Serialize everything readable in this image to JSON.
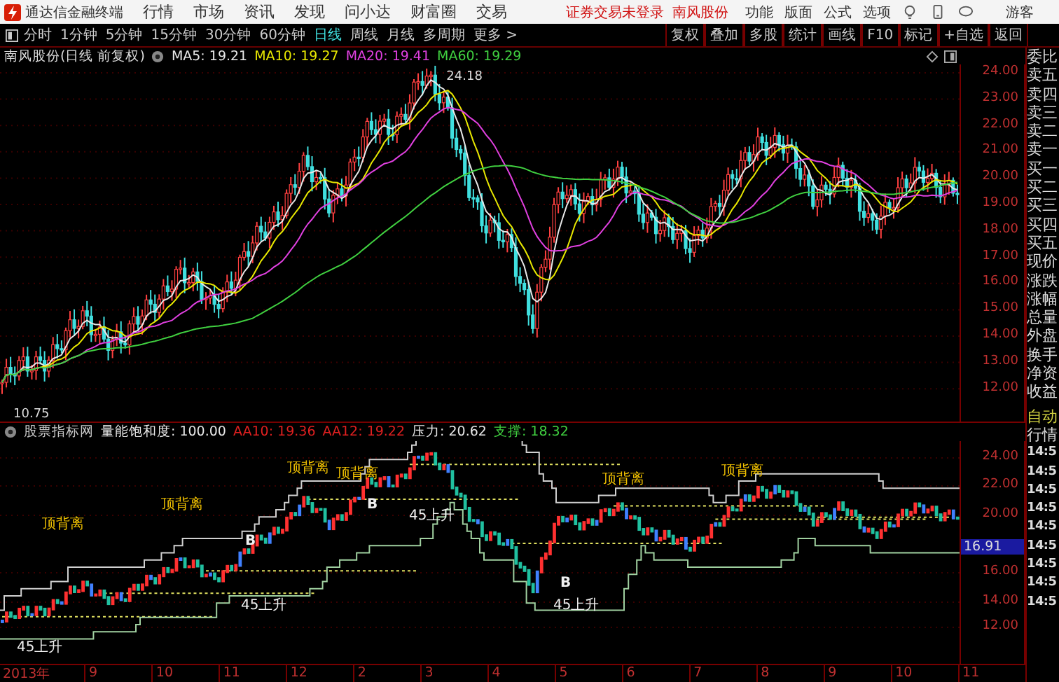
{
  "title_bar": {
    "app_name": "通达信金融终端",
    "menu": [
      "行情",
      "市场",
      "资讯",
      "发现",
      "问小达",
      "财富圈",
      "交易"
    ],
    "login_status": "证券交易未登录",
    "stock_name": "南风股份",
    "tools": [
      "功能",
      "版面",
      "公式",
      "选项"
    ],
    "user": "游客"
  },
  "toolbar": {
    "periods": [
      {
        "label": "分时",
        "selected": false
      },
      {
        "label": "1分钟",
        "selected": false
      },
      {
        "label": "5分钟",
        "selected": false
      },
      {
        "label": "15分钟",
        "selected": false
      },
      {
        "label": "30分钟",
        "selected": false
      },
      {
        "label": "60分钟",
        "selected": false
      },
      {
        "label": "日线",
        "selected": true
      },
      {
        "label": "周线",
        "selected": false
      },
      {
        "label": "月线",
        "selected": false
      },
      {
        "label": "多周期",
        "selected": false
      },
      {
        "label": "更多 >",
        "selected": false
      }
    ],
    "buttons": [
      "复权",
      "叠加",
      "多股",
      "统计",
      "画线",
      "F10",
      "标记",
      "+自选",
      "返回"
    ]
  },
  "price_chart": {
    "title": "南风股份(日线 前复权)",
    "legend": [
      {
        "label": "MA5: 19.21",
        "color": "#e8e8e8"
      },
      {
        "label": "MA10: 19.27",
        "color": "#e8e800"
      },
      {
        "label": "MA20: 19.41",
        "color": "#e040e0"
      },
      {
        "label": "MA60: 19.29",
        "color": "#40d040"
      }
    ],
    "high_label": "24.18",
    "low_label": "10.75",
    "axis_labels": [
      "24.00",
      "23.00",
      "22.00",
      "21.00",
      "20.00",
      "19.00",
      "18.00",
      "17.00",
      "16.00",
      "15.00",
      "14.00",
      "13.00",
      "12.00"
    ]
  },
  "indicator_chart": {
    "legend": [
      {
        "label": "股票指标网",
        "color": "#c8c8c8"
      },
      {
        "label": "量能饱和度: 100.00",
        "color": "#e8e8e8"
      },
      {
        "label": "AA10: 19.36",
        "color": "#e02020"
      },
      {
        "label": "AA12: 19.22",
        "color": "#e02020"
      },
      {
        "label": "压力: 20.62",
        "color": "#e8e8e8"
      },
      {
        "label": "支撑: 18.32",
        "color": "#40d040"
      }
    ],
    "annotations": [
      {
        "kind": "divergence",
        "text": "顶背离"
      },
      {
        "kind": "divergence",
        "text": "顶背离"
      },
      {
        "kind": "divergence",
        "text": "顶背离"
      },
      {
        "kind": "divergence",
        "text": "顶背离"
      },
      {
        "kind": "divergence",
        "text": "顶背离"
      },
      {
        "kind": "divergence",
        "text": "顶背离"
      },
      {
        "kind": "rise",
        "text": "45上升"
      },
      {
        "kind": "rise",
        "text": "45上升"
      },
      {
        "kind": "rise",
        "text": "45上升"
      },
      {
        "kind": "rise",
        "text": "45上升"
      },
      {
        "kind": "buy",
        "text": "B"
      },
      {
        "kind": "buy",
        "text": "B"
      },
      {
        "kind": "buy",
        "text": "B"
      }
    ],
    "axis_labels": [
      "24.00",
      "22.00",
      "20.00",
      "16.00",
      "14.00",
      "12.00"
    ],
    "price_tag": "16.91"
  },
  "date_axis": [
    "2013年",
    "9",
    "10",
    "11",
    "12",
    "2",
    "3",
    "4",
    "5",
    "6",
    "7",
    "8",
    "9",
    "10",
    "11"
  ],
  "quote_panel": {
    "labels": [
      "委比",
      "卖五",
      "卖四",
      "卖三",
      "卖二",
      "卖一",
      "买一",
      "买二",
      "买三",
      "买四",
      "买五",
      "现价",
      "涨跌",
      "涨幅",
      "总量",
      "外盘",
      "换手",
      "净资",
      "收益"
    ],
    "auto_label": "自动",
    "feed_label": "行情",
    "times": [
      "14:5",
      "14:5",
      "14:5",
      "14:5",
      "14:5",
      "14:5",
      "14:5",
      "14:5",
      "14:5"
    ]
  }
}
